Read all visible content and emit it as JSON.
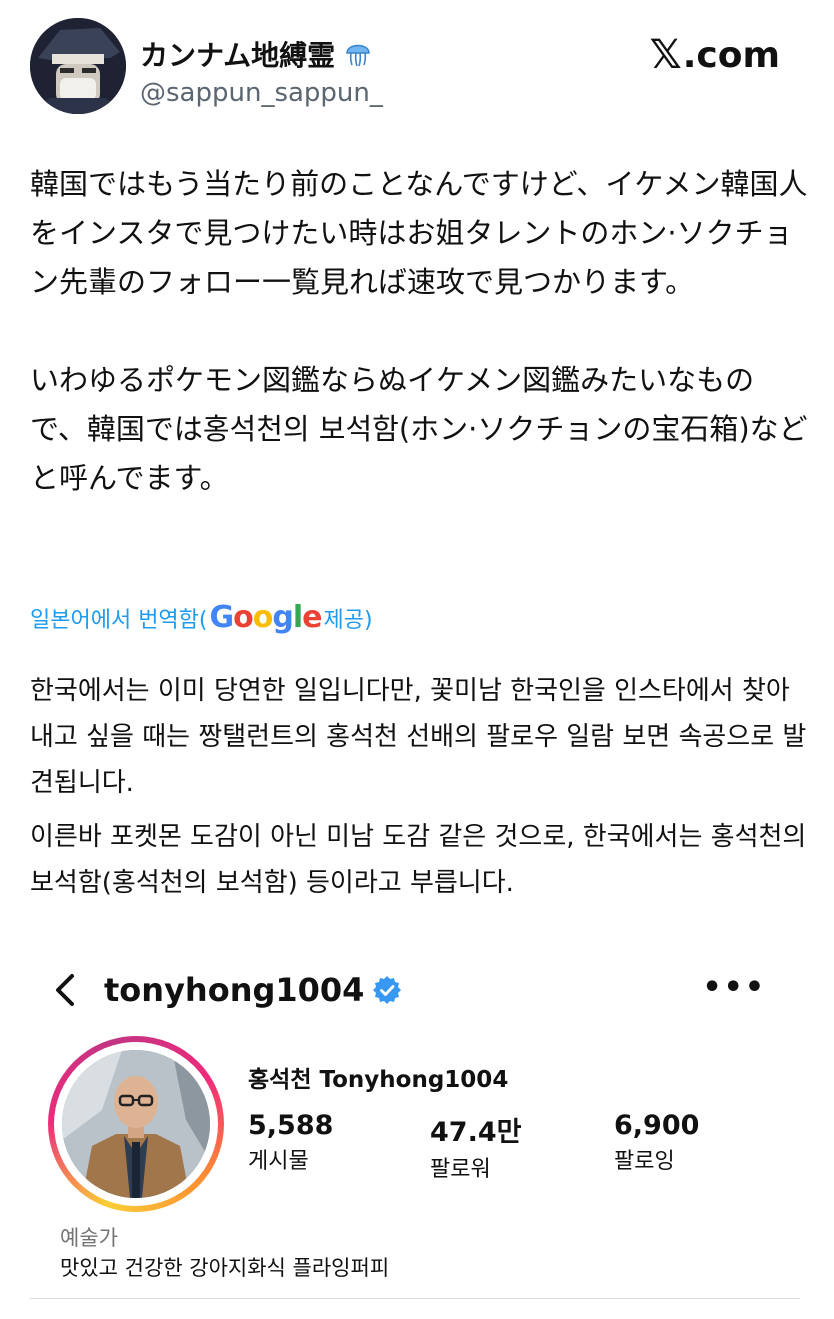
{
  "post": {
    "author_name": "カンナム地縛霊",
    "author_badge_icon": "jellyfish-emoji",
    "handle": "@sappun_sappun_",
    "brand": {
      "glyph": "𝕏",
      "suffix": ".com"
    },
    "paragraphs": [
      "韓国ではもう当たり前のことなんですけど、イケメン韓国人をインスタで見つけたい時はお姐タレントのホン·ソクチョン先輩のフォロー一覧見れば速攻で見つかります。",
      "いわゆるポケモン図鑑ならぬイケメン図鑑みたいなもので、韓国では홍석천의 보석함(ホン·ソクチョンの宝石箱)などと呼んでます。"
    ]
  },
  "translation": {
    "prefix": "일본어에서 번역함(",
    "provider": "Google",
    "suffix": " 제공)",
    "link_color": "#1d9bf0",
    "paragraphs": [
      "한국에서는 이미 당연한 일입니다만, 꽃미남 한국인을 인스타에서 찾아내고 싶을 때는 짱탤런트의 홍석천 선배의 팔로우 일람 보면 속공으로 발견됩니다.",
      "이른바 포켓몬 도감이 아닌 미남 도감 같은 것으로, 한국에서는 홍석천의 보석함(홍석천의 보석함) 등이라고 부릅니다."
    ]
  },
  "instagram": {
    "username": "tonyhong1004",
    "verified_color": "#3897f0",
    "full_name": "홍석천 Tonyhong1004",
    "stats": [
      {
        "value": "5,588",
        "label": "게시물"
      },
      {
        "value": "47.4만",
        "label": "팔로워"
      },
      {
        "value": "6,900",
        "label": "팔로잉"
      }
    ],
    "category": "예술가",
    "bio": "맛있고 건강한 강아지화식 플라잉퍼피"
  }
}
